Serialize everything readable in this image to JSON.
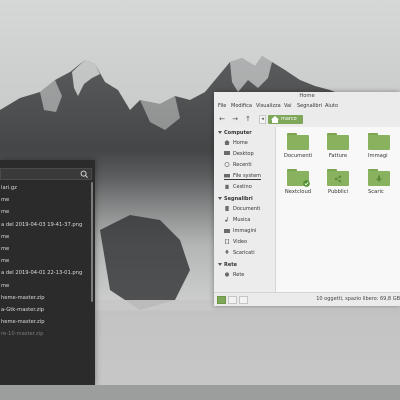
{
  "dark_window": {
    "items": [
      {
        "label": "lari.gz"
      },
      {
        "label": "me"
      },
      {
        "label": "me"
      },
      {
        "label": "a del 2019-04-03 19-41-37.png"
      },
      {
        "label": "me"
      },
      {
        "label": "me"
      },
      {
        "label": "me"
      },
      {
        "label": "a del 2019-04-01 22-13-01.png"
      },
      {
        "label": "me"
      },
      {
        "label": "heme-master.zip"
      },
      {
        "label": "a-Gtk-master.zip"
      },
      {
        "label": "heme-master.zip"
      },
      {
        "label": "re-10-master.zip"
      }
    ]
  },
  "nemo": {
    "title": "Home",
    "menu": [
      "File",
      "Modifica",
      "Visualizza",
      "Vai",
      "Segnalibri",
      "Aiuto"
    ],
    "breadcrumb": "marco",
    "sidebar": {
      "sections": [
        {
          "title": "Computer",
          "items": [
            "Home",
            "Desktop",
            "Recenti",
            "File system",
            "Cestino"
          ]
        },
        {
          "title": "Segnalibri",
          "items": [
            "Documenti",
            "Musica",
            "Immagini",
            "Video",
            "Scaricati"
          ]
        },
        {
          "title": "Rete",
          "items": [
            "Rete"
          ]
        }
      ]
    },
    "files": [
      "Documenti",
      "Fatture",
      "Immagi",
      "Nextcloud",
      "Pubblici",
      "Scaric"
    ],
    "status": "10 oggetti, spazio libero: 69,8 GB",
    "colors": {
      "accent": "#7fa759",
      "folder": "#89b25f"
    }
  }
}
